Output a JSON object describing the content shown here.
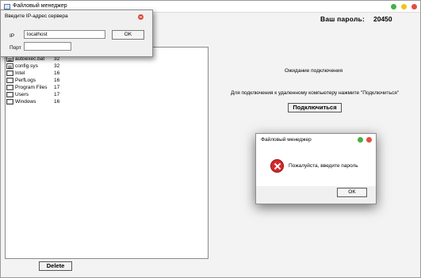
{
  "window": {
    "title": "Файловый менеджер",
    "password_label": "Ваш пароль:",
    "password_value": "20450"
  },
  "files": [
    {
      "name": "autoexec.bat",
      "size": "32",
      "icon": "doc-icon"
    },
    {
      "name": "config.sys",
      "size": "32",
      "icon": "doc-icon"
    },
    {
      "name": "Intel",
      "size": "16",
      "icon": "folder-icon"
    },
    {
      "name": "PerfLogs",
      "size": "16",
      "icon": "folder-icon"
    },
    {
      "name": "Program Files",
      "size": "17",
      "icon": "folder-icon"
    },
    {
      "name": "Users",
      "size": "17",
      "icon": "folder-icon"
    },
    {
      "name": "Windows",
      "size": "16",
      "icon": "folder-icon"
    }
  ],
  "actions": {
    "delete_label": "Delete",
    "connect_label": "Подключиться"
  },
  "status": {
    "waiting": "Ожидание подключения",
    "hint": "Для подключения к удаленному компьютеру нажмите \"Подключиться\""
  },
  "ip_dialog": {
    "title": "Введите IP-адрес сервера",
    "ip_label": "IP",
    "ip_value": "localhost",
    "port_label": "Порт",
    "port_value": "",
    "ok_label": "OK"
  },
  "error_dialog": {
    "title": "Файловый менеджер",
    "message": "Пожалуйста, введите пароль",
    "ok_label": "OK"
  },
  "colors": {
    "close": "#e05040",
    "maximize": "#f0c419",
    "minimize": "#44b044",
    "error_icon": "#d42a2a"
  }
}
